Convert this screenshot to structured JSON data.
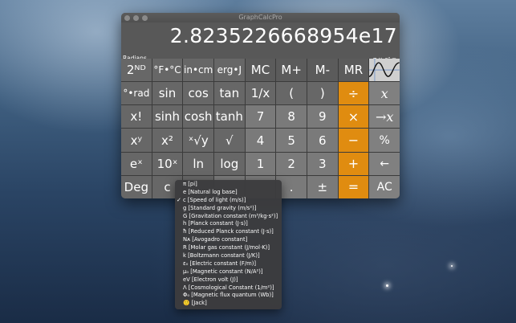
{
  "window": {
    "title": "GraphCalcPro"
  },
  "display": {
    "value": "2.8235226668954e17",
    "mode": "Radians",
    "formula": "π × c² ="
  },
  "keys": {
    "row1": [
      "2ᴺᴰ",
      "°F•°C",
      "in•cm",
      "erg•J",
      "MC",
      "M+",
      "M-",
      "MR"
    ],
    "row2": [
      "°•rad",
      "sin",
      "cos",
      "tan",
      "1/x",
      "(",
      ")",
      "÷",
      "x"
    ],
    "row3": [
      "x!",
      "sinh",
      "cosh",
      "tanh",
      "7",
      "8",
      "9",
      "×",
      "→x"
    ],
    "row4": [
      "xʸ",
      "x²",
      "ˣ√y",
      "√",
      "4",
      "5",
      "6",
      "−",
      "%"
    ],
    "row5": [
      "eˣ",
      "10ˣ",
      "ln",
      "log",
      "1",
      "2",
      "3",
      "+",
      "←"
    ],
    "row6": [
      "Deg",
      "c",
      "",
      "",
      "",
      ".",
      "±",
      "=",
      "AC"
    ]
  },
  "graph_icon": "sine-graph-icon",
  "constants_menu": {
    "items": [
      {
        "label": "π [pi]",
        "checked": false
      },
      {
        "label": "e [Natural log base]",
        "checked": false
      },
      {
        "label": "c [Speed of light (m/s)]",
        "checked": true
      },
      {
        "label": "g [Standard gravity (m/s²)]",
        "checked": false
      },
      {
        "label": "G [Gravitation constant (m³/kg·s²)]",
        "checked": false
      },
      {
        "label": "h [Planck constant (J·s)]",
        "checked": false
      },
      {
        "label": "ħ [Reduced Planck constant (J·s)]",
        "checked": false
      },
      {
        "label": "Nᴀ [Avogadro constant]",
        "checked": false
      },
      {
        "label": "R [Molar gas constant (J/mol·K)]",
        "checked": false
      },
      {
        "label": "k [Boltzmann constant (J/K)]",
        "checked": false
      },
      {
        "label": "ε₀ [Electric constant (F/m)]",
        "checked": false
      },
      {
        "label": "μ₀ [Magnetic constant (N/A²)]",
        "checked": false
      },
      {
        "label": "eV [Electron volt (J)]",
        "checked": false
      },
      {
        "label": "Λ [Cosmological Constant (1/m²)]",
        "checked": false
      },
      {
        "label": "Φ₀ [Magnetic flux quantum (Wb)]",
        "checked": false
      },
      {
        "label": "🙂 [Jack]",
        "checked": false
      }
    ],
    "check_mark": "✓"
  },
  "colors": {
    "operator_orange": "#e08c10",
    "key_gray": "#676767",
    "digit_gray": "#7a7a7a",
    "display_bg": "#585858"
  }
}
